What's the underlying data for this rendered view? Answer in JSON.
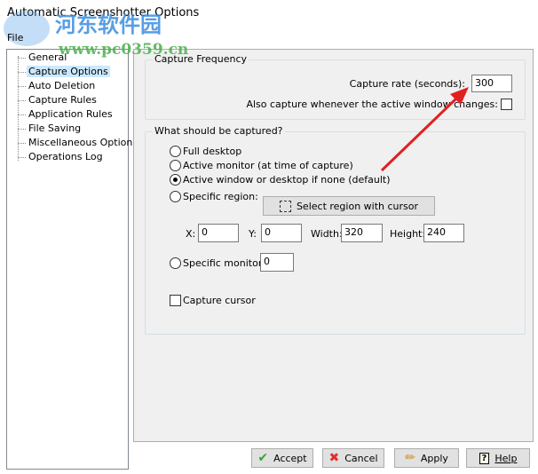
{
  "window": {
    "title": "Automatic Screenshotter Options"
  },
  "menu": {
    "file": "File"
  },
  "sidebar": {
    "items": [
      {
        "label": "General"
      },
      {
        "label": "Capture Options",
        "selected": true
      },
      {
        "label": "Auto Deletion"
      },
      {
        "label": "Capture Rules"
      },
      {
        "label": "Application Rules"
      },
      {
        "label": "File Saving"
      },
      {
        "label": "Miscellaneous Options"
      },
      {
        "label": "Operations Log"
      }
    ]
  },
  "frequency": {
    "title": "Capture Frequency",
    "rate_label": "Capture rate (seconds):",
    "rate_value": "300",
    "also_label": "Also capture whenever the active window changes:",
    "also_checked": false
  },
  "capture": {
    "title": "What should be captured?",
    "options": {
      "full": "Full desktop",
      "monitor": "Active monitor (at time of capture)",
      "window": "Active window or desktop if none (default)",
      "region": "Specific region:",
      "specific_monitor": "Specific monitor:"
    },
    "selected": "window",
    "select_region_button": "Select region with cursor",
    "x_label": "X:",
    "x_value": "0",
    "y_label": "Y:",
    "y_value": "0",
    "width_label": "Width:",
    "width_value": "320",
    "height_label": "Height:",
    "height_value": "240",
    "monitor_value": "0",
    "cursor_label": "Capture cursor",
    "cursor_checked": false
  },
  "buttons": {
    "accept": "Accept",
    "cancel": "Cancel",
    "apply": "Apply",
    "help": "Help"
  },
  "watermark": {
    "text": "河东软件园",
    "url": "www.pc0359.cn"
  },
  "colors": {
    "arrow": "#e02020",
    "selection": "#cce8ff"
  }
}
